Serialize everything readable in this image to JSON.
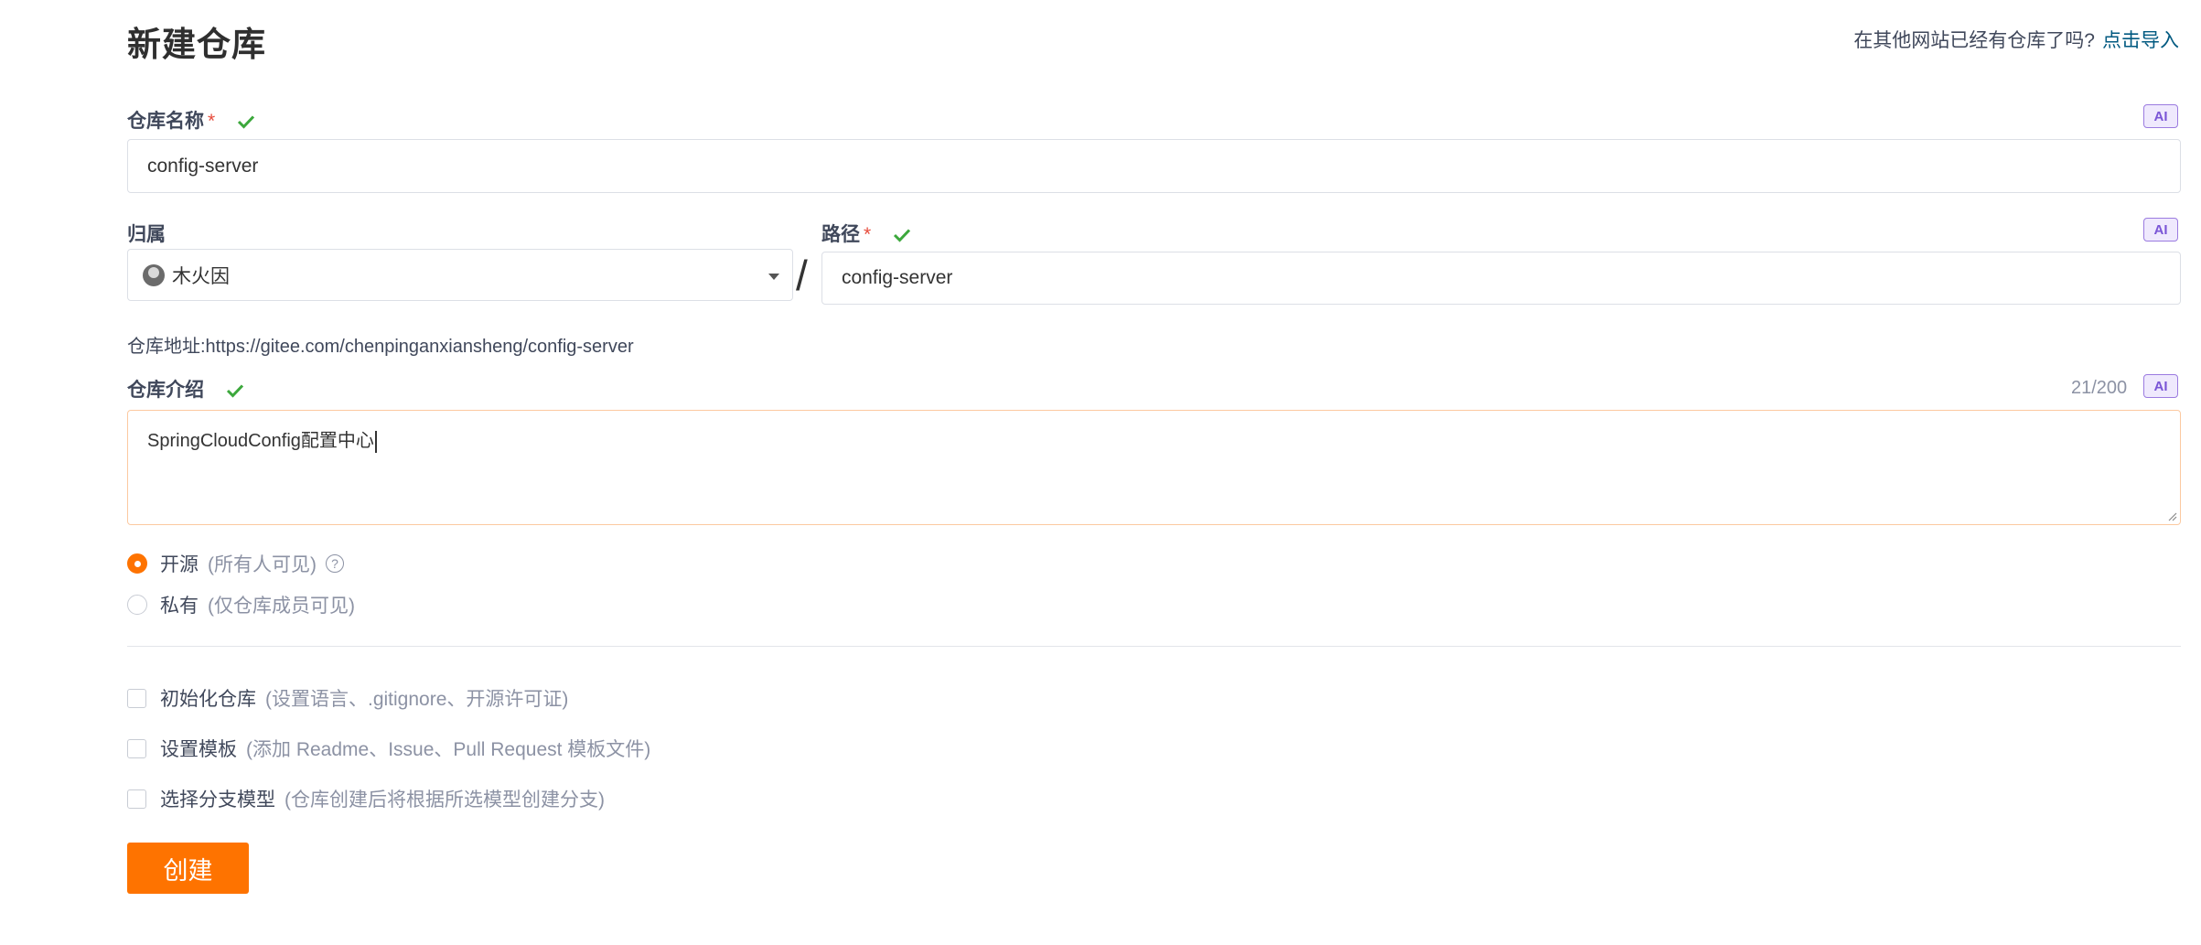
{
  "header": {
    "title": "新建仓库",
    "import_prompt": "在其他网站已经有仓库了吗?",
    "import_link": "点击导入"
  },
  "repo_name": {
    "label": "仓库名称",
    "required_mark": "*",
    "value": "config-server",
    "ai_label": "AI"
  },
  "owner": {
    "label": "归属",
    "value": "木火因"
  },
  "separator": "/",
  "path": {
    "label": "路径",
    "required_mark": "*",
    "value": "config-server",
    "ai_label": "AI"
  },
  "repo_address": "仓库地址:https://gitee.com/chenpinganxiansheng/config-server",
  "description": {
    "label": "仓库介绍",
    "counter": "21/200",
    "value": "SpringCloudConfig配置中心",
    "ai_label": "AI"
  },
  "visibility": {
    "public_label": "开源",
    "public_hint": "(所有人可见)",
    "private_label": "私有",
    "private_hint": "(仅仓库成员可见)",
    "help_glyph": "?",
    "selected": "public"
  },
  "options": [
    {
      "label": "初始化仓库",
      "hint": "(设置语言、.gitignore、开源许可证)",
      "checked": false
    },
    {
      "label": "设置模板",
      "hint": "(添加 Readme、Issue、Pull Request 模板文件)",
      "checked": false
    },
    {
      "label": "选择分支模型",
      "hint": "(仓库创建后将根据所选模型创建分支)",
      "checked": false
    }
  ],
  "create_button": "创建",
  "colors": {
    "accent": "#fe7300",
    "link": "#005980",
    "success": "#3ca83c",
    "ai": "#7a55d6"
  }
}
